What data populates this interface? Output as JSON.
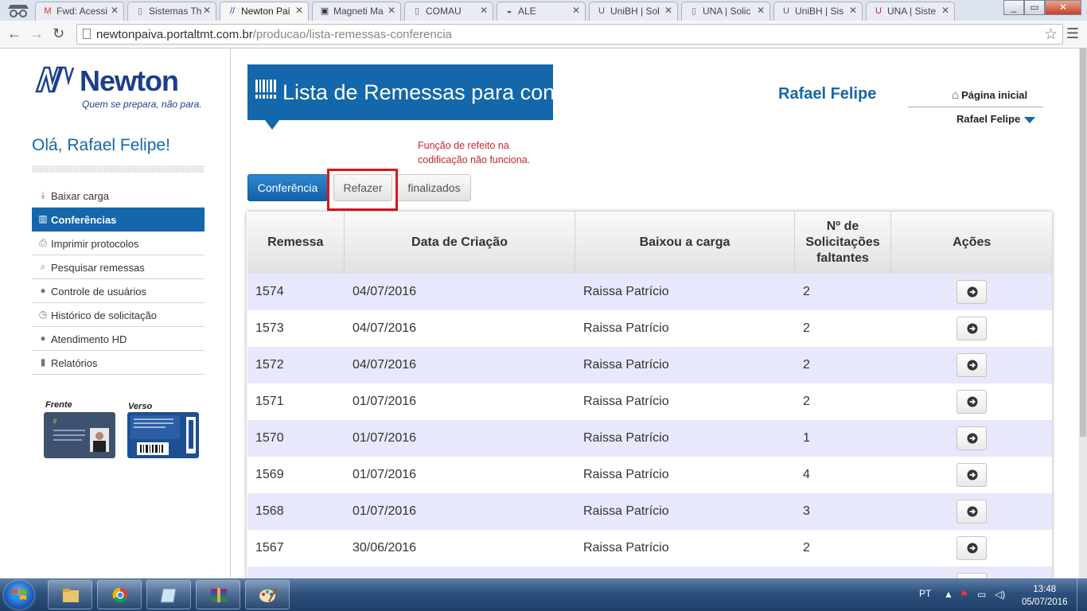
{
  "browser": {
    "tabs": [
      {
        "icon": "gmail-icon",
        "title": "Fwd: Acessi"
      },
      {
        "icon": "page-icon",
        "title": "Sistemas Th"
      },
      {
        "icon": "newton-icon",
        "title": "Newton Pai",
        "active": true
      },
      {
        "icon": "magneti-icon",
        "title": "Magneti Ma"
      },
      {
        "icon": "page-icon",
        "title": "COMAU"
      },
      {
        "icon": "ale-icon",
        "title": "ALE"
      },
      {
        "icon": "unibh-icon",
        "title": "UniBH | Sol"
      },
      {
        "icon": "page-icon",
        "title": "UNA | Solic"
      },
      {
        "icon": "unibh-icon",
        "title": "UniBH | Sis"
      },
      {
        "icon": "una-icon",
        "title": "UNA | Siste"
      }
    ],
    "url_host": "newtonpaiva.portaltmt.com.br",
    "url_path": "/producao/lista-remessas-conferencia"
  },
  "sidebar": {
    "brand": "Newton",
    "tagline": "Quem se prepara, não para.",
    "greeting": "Olá, Rafael Felipe!",
    "menu": [
      {
        "icon": "download-icon",
        "label": "Baixar carga"
      },
      {
        "icon": "barcode-icon",
        "label": "Conferências",
        "active": true
      },
      {
        "icon": "printer-icon",
        "label": "Imprimir protocolos"
      },
      {
        "icon": "search-icon",
        "label": "Pesquisar remessas"
      },
      {
        "icon": "user-icon",
        "label": "Controle de usuários"
      },
      {
        "icon": "clock-icon",
        "label": "Histórico de solicitação"
      },
      {
        "icon": "user-icon",
        "label": "Atendimento HD"
      },
      {
        "icon": "bar-chart-icon",
        "label": "Relatórios"
      }
    ],
    "card_front_label": "Frente",
    "card_back_label": "Verso"
  },
  "main": {
    "banner_title": "Lista de Remessas para conferência",
    "user_name": "Rafael Felipe",
    "home_link": "Página inicial",
    "user_menu": "Rafael Felipe",
    "annotation": "Função de refeito na codificação não funciona.",
    "tabs": {
      "conferencia": "Conferência",
      "refazer": "Refazer",
      "finalizados": "finalizados"
    },
    "table": {
      "headers": [
        "Remessa",
        "Data de Criação",
        "Baixou a carga",
        "Nº de Solicitações faltantes",
        "Ações"
      ],
      "rows": [
        {
          "remessa": "1574",
          "data": "04/07/2016",
          "baixou": "Raissa Patrício",
          "faltantes": "2"
        },
        {
          "remessa": "1573",
          "data": "04/07/2016",
          "baixou": "Raissa Patrício",
          "faltantes": "2"
        },
        {
          "remessa": "1572",
          "data": "04/07/2016",
          "baixou": "Raissa Patrício",
          "faltantes": "2"
        },
        {
          "remessa": "1571",
          "data": "01/07/2016",
          "baixou": "Raissa Patrício",
          "faltantes": "2"
        },
        {
          "remessa": "1570",
          "data": "01/07/2016",
          "baixou": "Raissa Patrício",
          "faltantes": "1"
        },
        {
          "remessa": "1569",
          "data": "01/07/2016",
          "baixou": "Raissa Patrício",
          "faltantes": "4"
        },
        {
          "remessa": "1568",
          "data": "01/07/2016",
          "baixou": "Raissa Patrício",
          "faltantes": "3"
        },
        {
          "remessa": "1567",
          "data": "30/06/2016",
          "baixou": "Raissa Patrício",
          "faltantes": "2"
        },
        {
          "remessa": "",
          "data": "",
          "baixou": "",
          "faltantes": ""
        }
      ]
    }
  },
  "taskbar": {
    "apps": [
      "explorer-icon",
      "chrome-icon",
      "notepad-icon",
      "winrar-icon",
      "paint-icon"
    ],
    "language": "PT",
    "time": "13:48",
    "date": "05/07/2016"
  },
  "colors": {
    "primary": "#1467ab",
    "row_alt": "#e7e8fb",
    "annotation": "#c0262c",
    "highlight": "#e0141b"
  }
}
